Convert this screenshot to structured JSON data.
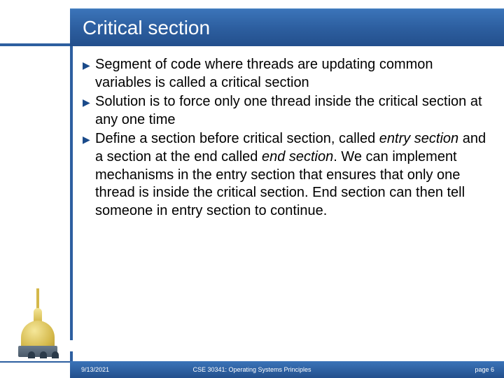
{
  "title": "Critical section",
  "bullets": [
    {
      "pre": "Segment of code where threads are updating common variables is called a critical section",
      "i1": "",
      "mid": "",
      "i2": "",
      "post": ""
    },
    {
      "pre": "Solution is to force only one thread inside the critical section at any one time",
      "i1": "",
      "mid": "",
      "i2": "",
      "post": ""
    },
    {
      "pre": "Define a section before critical section, called ",
      "i1": "entry section",
      "mid": " and a section at the end called ",
      "i2": "end section",
      "post": ". We can implement mechanisms in the entry section that ensures that only one thread is inside the critical section. End section can then tell someone in entry section to continue."
    }
  ],
  "footer": {
    "date": "9/13/2021",
    "course": "CSE 30341: Operating Systems Principles",
    "page": "page 6"
  },
  "icons": {
    "bullet_glyph": "▶"
  }
}
